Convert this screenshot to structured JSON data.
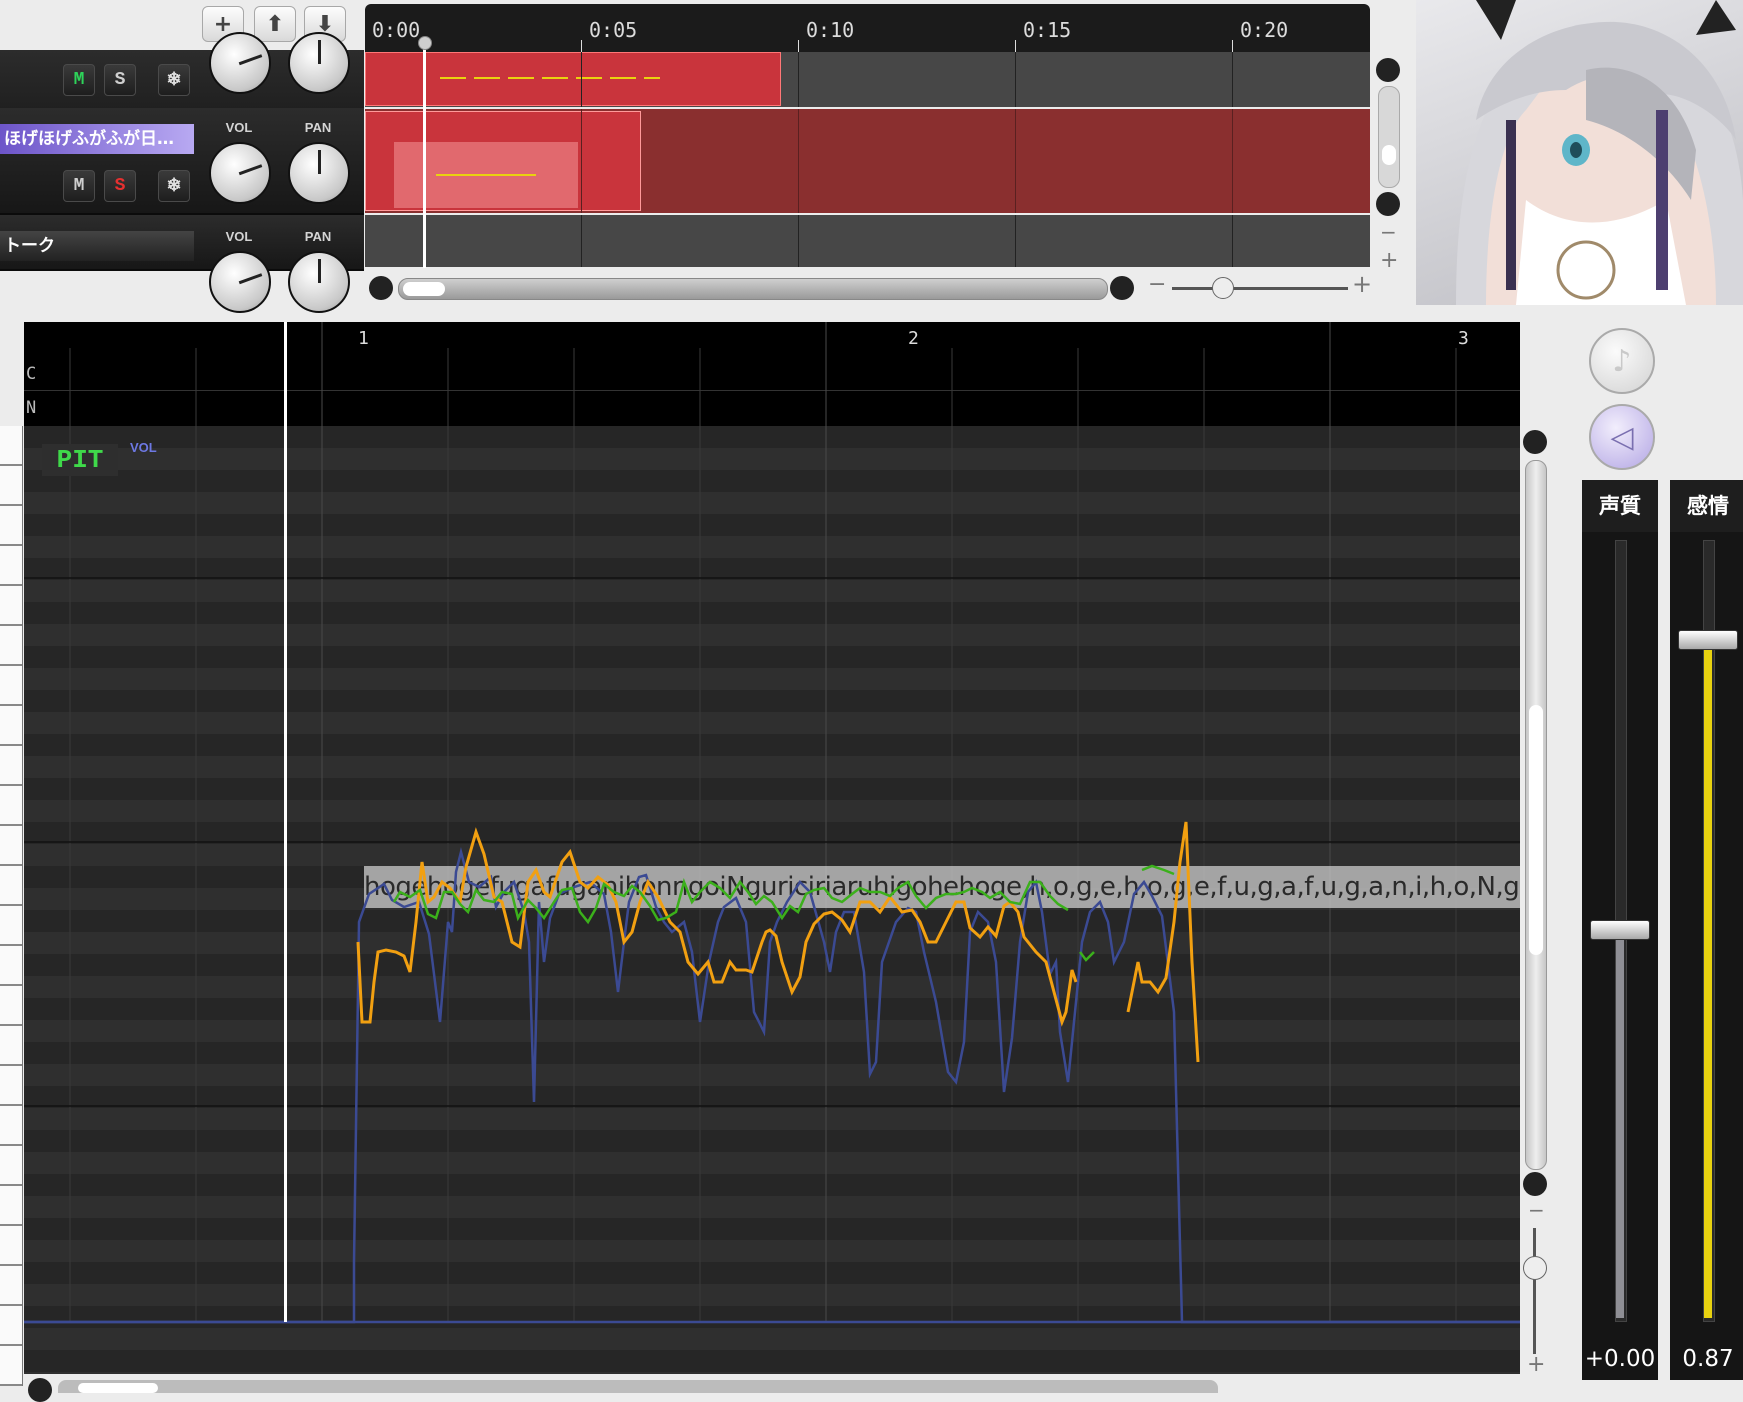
{
  "toolbar": {
    "add_label": "+",
    "up_label": "⬆",
    "down_label": "⬇"
  },
  "timeline": {
    "labels": [
      "0:00",
      "0:05",
      "0:10",
      "0:15",
      "0:20"
    ]
  },
  "tracks": [
    {
      "name": "",
      "mute_label": "M",
      "solo_label": "S",
      "freeze_label": "❄",
      "vol_label": "",
      "pan_label": ""
    },
    {
      "name": "ほげほげふがふが日…",
      "mute_label": "M",
      "solo_label": "S",
      "freeze_label": "❄",
      "vol_label": "VOL",
      "pan_label": "PAN"
    },
    {
      "name": "トーク",
      "vol_label": "VOL",
      "pan_label": "PAN"
    }
  ],
  "zoom": {
    "minus": "−",
    "plus": "+"
  },
  "roll": {
    "bar_numbers": [
      "1",
      "2",
      "3"
    ],
    "row_labels": [
      "C",
      "N"
    ],
    "pit_label": "PIT",
    "vol_label": "VOL",
    "lyrics": "hogehogefugafuganihonngoiNguriciriaruhigohehoge,h,o,g,e,h,o,g,e,f,u,g,a,f,u,g,a,n,i,h,o,N,g,o,i,N,g,u,r"
  },
  "sidebar": {
    "voice_quality_label": "声質",
    "voice_quality_value": "+0.00",
    "emotion_label": "感情",
    "emotion_value": "0.87",
    "emotion_level": 0.87,
    "voice_quality_level": 0.5
  },
  "colors": {
    "clip_red": "#c9343c",
    "clip_dark_red": "#8a2f2f",
    "vol_curve": "#3b4a93",
    "pitch_orange": "#f2a011",
    "pitch_green": "#3bb01b",
    "emotion_yellow": "#e9d210",
    "mute_green": "#2ed45a",
    "solo_red": "#e63030"
  }
}
